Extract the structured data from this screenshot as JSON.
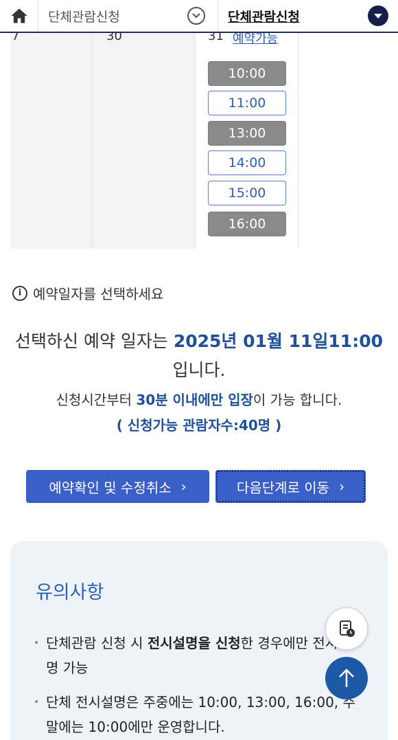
{
  "nav": {
    "home_icon": "home-icon",
    "crumb1": "단체관람신청",
    "crumb2": "단체관람신청"
  },
  "calendar": {
    "days": [
      "7",
      "30",
      "31"
    ],
    "cut_link": "예약가능",
    "slots": [
      {
        "time": "10:00",
        "status": "full"
      },
      {
        "time": "11:00",
        "status": "open"
      },
      {
        "time": "13:00",
        "status": "full"
      },
      {
        "time": "14:00",
        "status": "open"
      },
      {
        "time": "15:00",
        "status": "open"
      },
      {
        "time": "16:00",
        "status": "full"
      }
    ]
  },
  "hint": "예약일자를 선택하세요",
  "selection": {
    "prefix": "선택하신 예약 일자는 ",
    "date": "2025년 01월 11일11:00",
    "suffix": " 입니다.",
    "note_prefix": "신청시간부터 ",
    "note_highlight": "30분 이내에만 입장",
    "note_suffix": "이 가능 합니다.",
    "capacity": "( 신청가능 관람자수:40명 )"
  },
  "buttons": {
    "confirm": "예약확인 및 수정취소",
    "next": "다음단계로 이동",
    "chevron": "›"
  },
  "caution": {
    "title": "유의사항",
    "note1_a": "단체관람 신청 시 ",
    "note1_bold": "전시설명을 신청",
    "note1_b": "한 경우에만 전시설명 가능",
    "note2": "단체 전시설명은 주중에는 10:00, 13:00, 16:00, 주말에는 10:00에만 운영합니다."
  },
  "colors": {
    "accent": "#3a5fc6",
    "highlight": "#1f4f99",
    "slot_full": "#8a8a8a",
    "card_bg": "#eef2f9"
  }
}
